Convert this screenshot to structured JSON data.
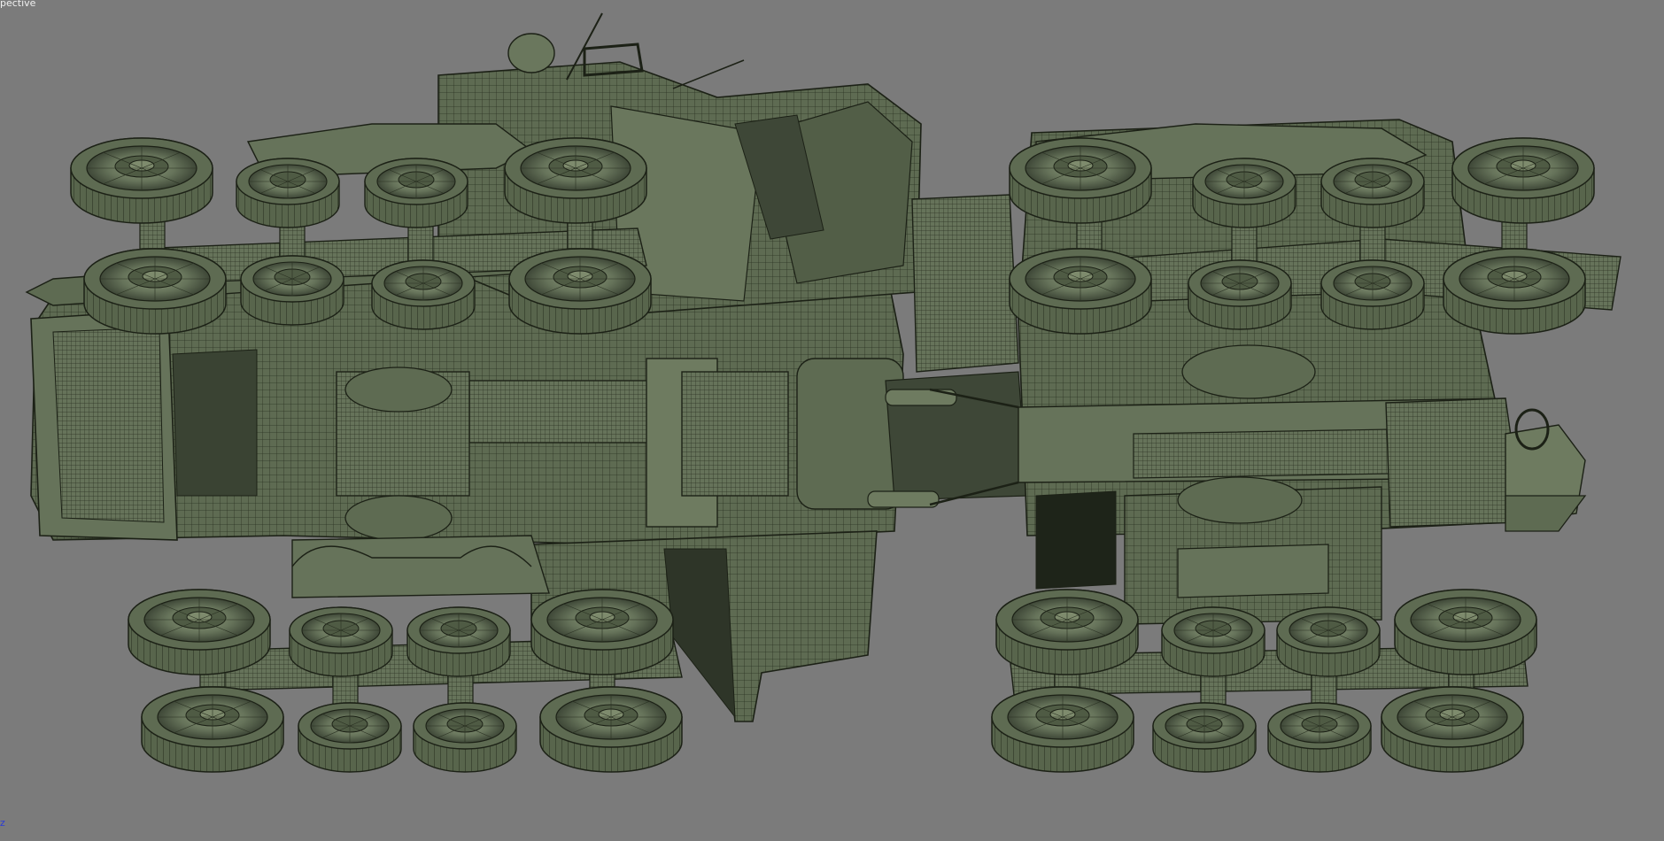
{
  "viewport": {
    "label": "pective",
    "axis_label": "z"
  },
  "model": {
    "wire_color": "#1c2116",
    "fill_color": "#5e6b52",
    "light_fill_color": "#707e62",
    "dark_fill_color": "#3e4737",
    "background_color": "#7b7b7b"
  }
}
